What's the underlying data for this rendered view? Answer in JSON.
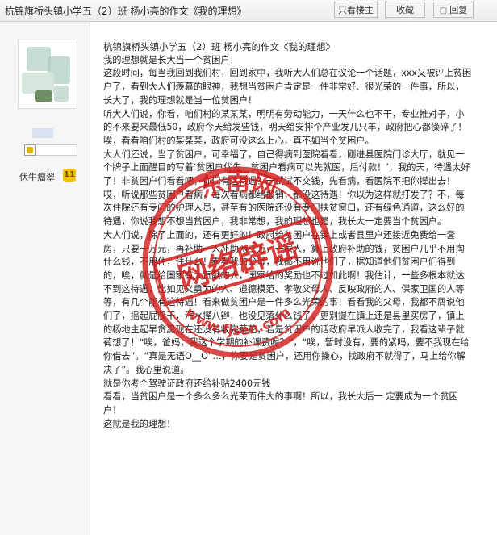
{
  "topbar": {
    "title": "杭锦旗桥头镇小学五（2）班 杨小亮的作文《我的理想》",
    "only_author_label": "只看楼主",
    "favorite_label": "收藏",
    "reply_label": "回复"
  },
  "user": {
    "title_text": "伏牛瘤翠",
    "level": "11"
  },
  "post": {
    "subtitle": "杭锦旗桥头镇小学五（2）班 杨小亮的作文《我的理想》",
    "paragraphs": [
      "我的理想就是长大当一个贫困户！",
      "这段时间，每当我回到我们村，回到家中，我听大人们总在议论一个话题，xxx又被评上贫困户了，看到大人们羡慕的眼神，我想当贫困户肯定是一件非常好、很光荣的一件事，所以，长大了，我的理想就是当一位贫困户！",
      "听大人们说，你看，咱们村的某某某，明明有劳动能力，一天什么也不干，专业推对子，小的不来要来最低50，政府今天给发些钱，明天给安排个产业发几只羊，政府把心都操碎了！唉，看看咱们村的某某某，政府可没这么上心，真不如当个贫困户。",
      "大人们还说，当了贫困户，可幸福了，自己得病到医院看看，刚进县医院门诊大厅，就见一个牌子上面醒目的写着‘贫困户优先，贫困户看病可以先就医，后付款！’，我的天，待遇太好了！非贫困户们看看吧，你们有这待遇？一试试不交钱，先看病，看医院不把你撵出去！哎，听说那些贫困户看病，每次看病都给报销，都没这待遇！你以为这样就打发了？不，每次住院还有专门的护理人员，甚至有的医院还设有专门扶贫窗口，还有绿色通道，这么好的待遇，你说我想不想当贫困户，我非常想，我的理想也是，我长大一定要当个贫困户。",
      "大人们说，除了上面的，还有更好的！政府给贫困户在镇上或者县里户还接近免费给一套房，只要一万元，再补助一人补助两三万，一家人，算上政府补助的钱，贫困户几乎不用掏什么钱，不用住，住什么！看看我的父母，我都不用说他们了，据知道他们贫困户们得到的，唉，就是给国家有大贡献的人，国家给的奖励也不过如此啊！我估计，一些多根本就达不到这待遇，比如见义勇为的人、道德模范、孝敬父母人、反映政府的人、保家卫国的人等等，有几个能有这待遇！看来做贫困户是一件多么光荣的事！看看我的父母，我都不屑说他们了，摇起屁股干，汗水撵八辫，也没见落什么钱了，更别提在镇上还是县里买房了，镇上的杨地主起早贪黑现在还没有收完葵花，若是贫困户的话政府早派人收完了，我看这辈子就荷想了！“唉，爸妈，我这个学期的补课费呢？”，“唉，暂时没有，要的紧吗，要不我现在给你借去”。“真是无语O__O”…，你要是贫困户，还用你操心，找政府不就得了，马上给你解决了”。我心里说道。",
      "就是你考个驾驶证政府还给补贴2400元钱",
      "看看，当贫困户是一个多么多么光荣而伟大的事啊！所以，我长大后一 定要成为一个贫困户！",
      "这就是我的理想！"
    ]
  },
  "watermark": {
    "line1": "东南网",
    "line2": "网络辟谣",
    "site": "www.fjsen.com",
    "color": "#d11a1a"
  }
}
